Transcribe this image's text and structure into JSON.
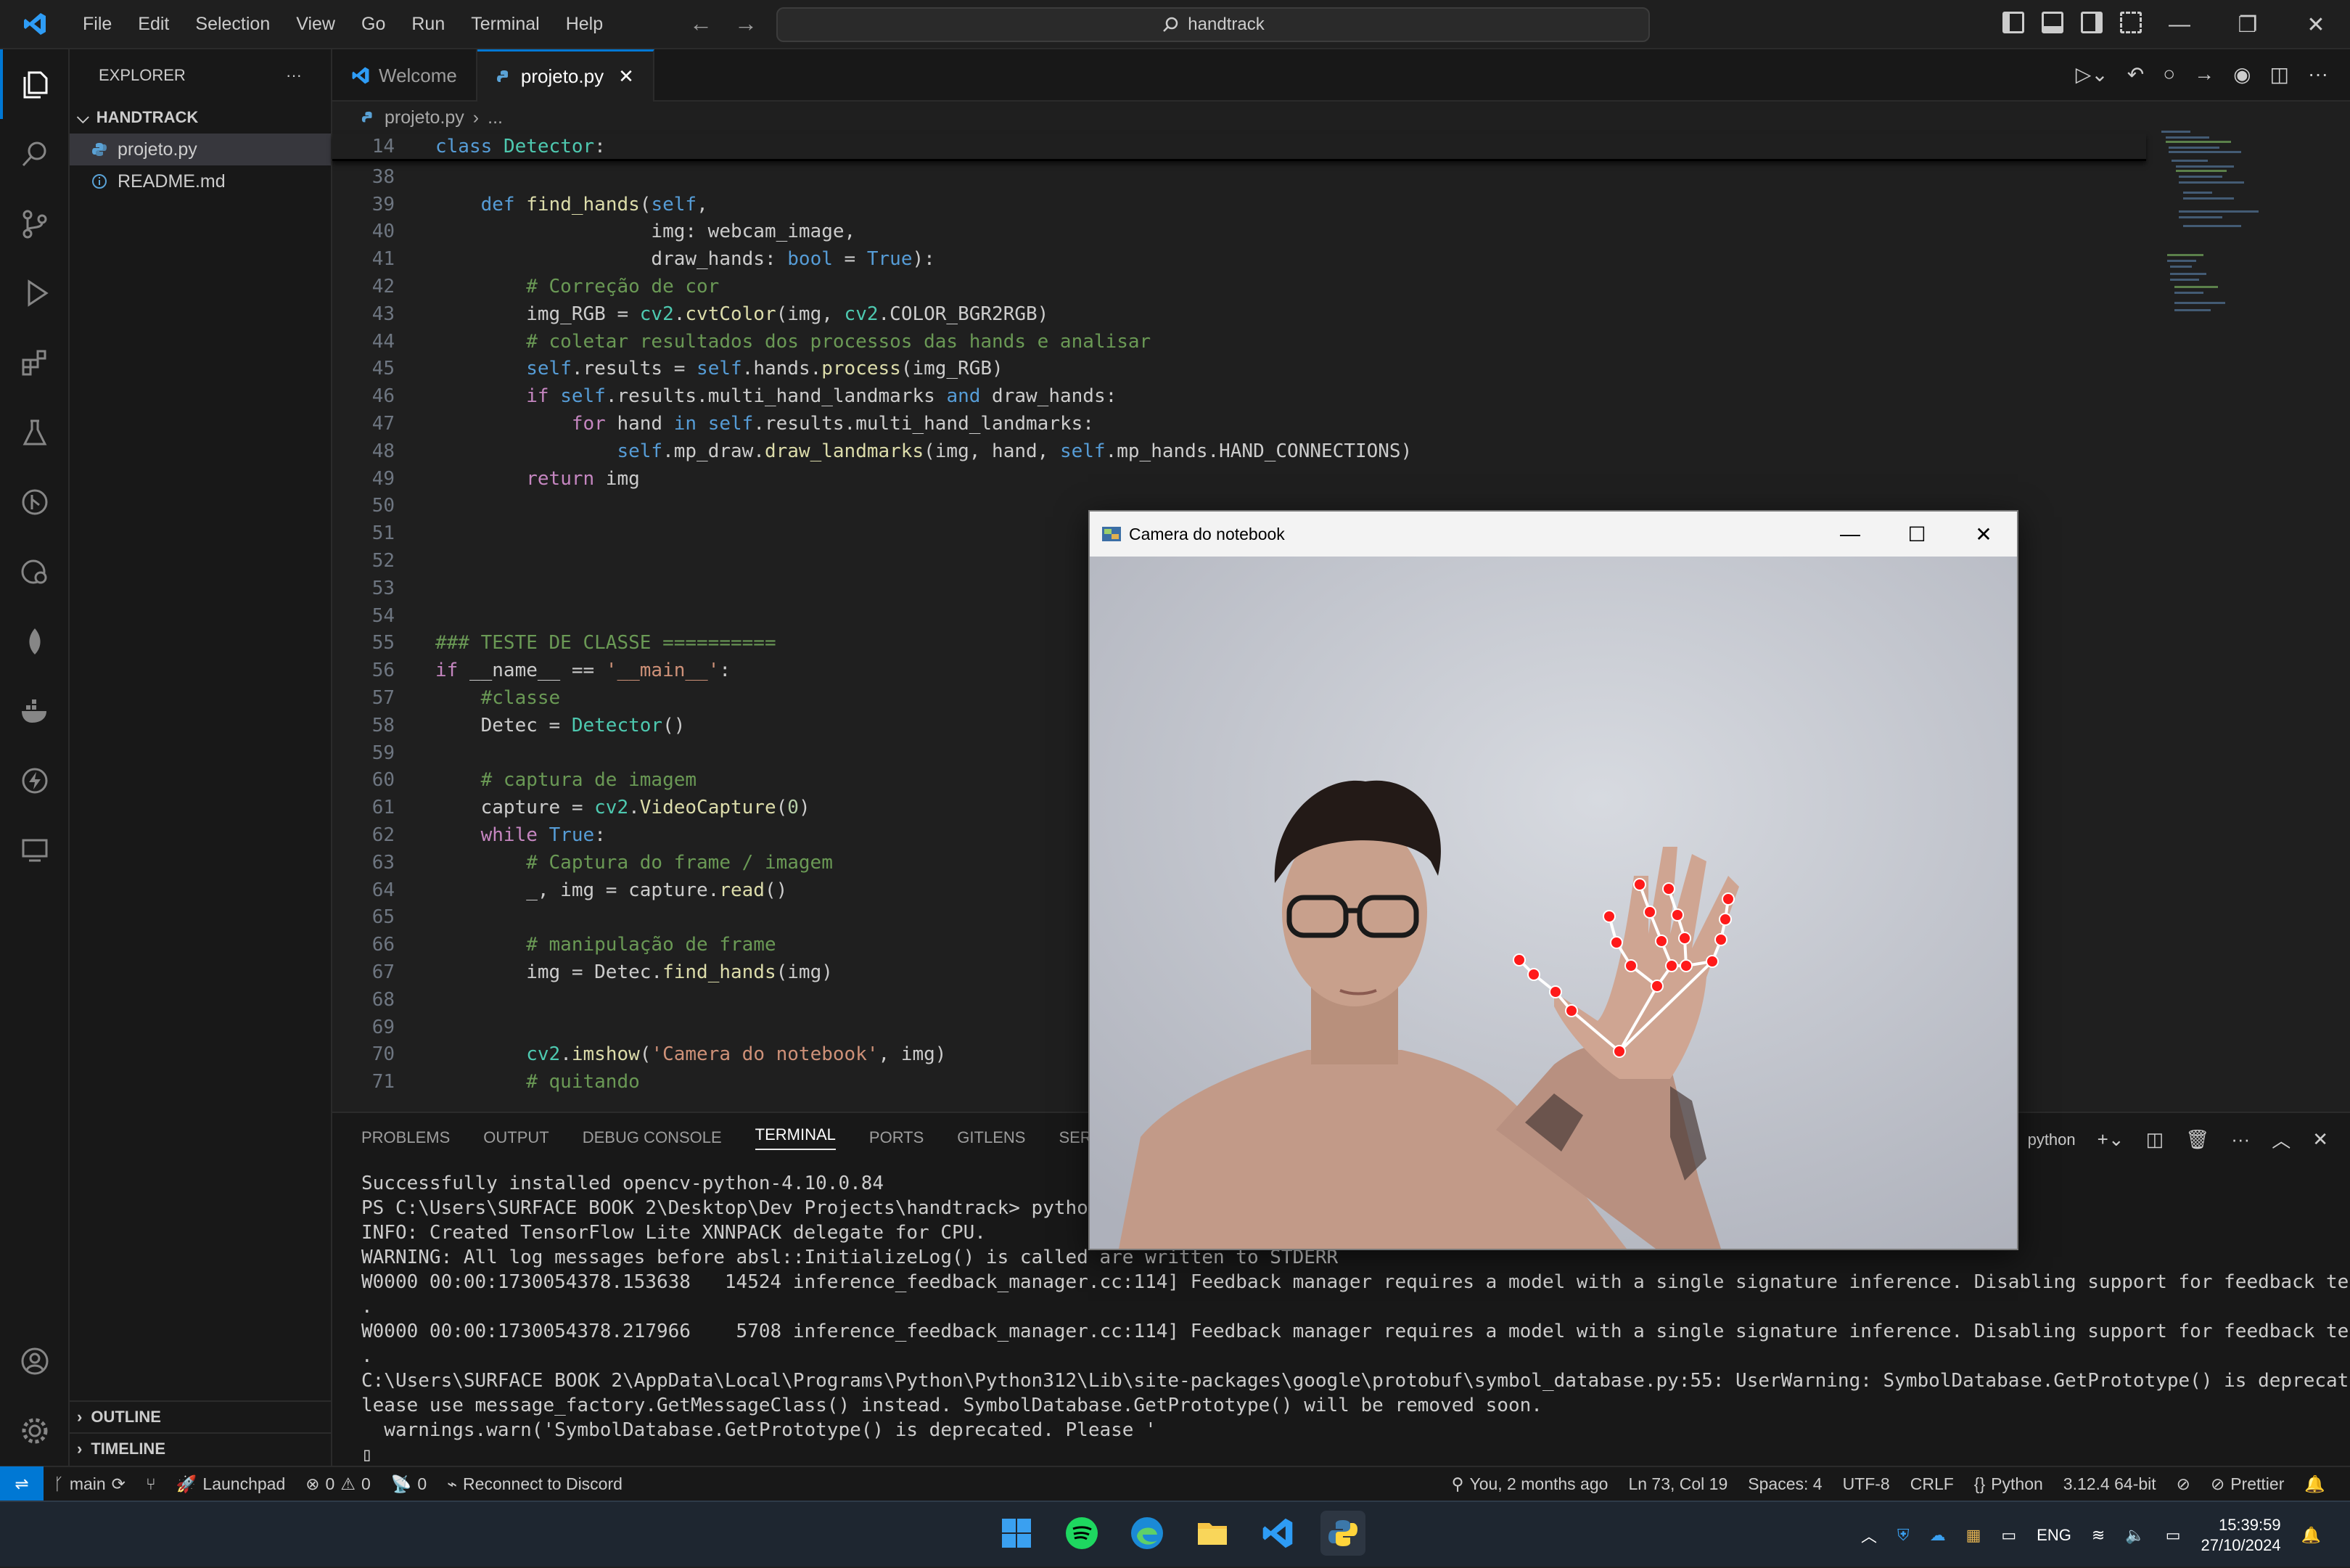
{
  "titlebar": {
    "menu": [
      "File",
      "Edit",
      "Selection",
      "View",
      "Go",
      "Run",
      "Terminal",
      "Help"
    ],
    "command_center": "handtrack"
  },
  "sidebar": {
    "header": "EXPLORER",
    "folder": "HANDTRACK",
    "files": [
      {
        "name": "projeto.py",
        "icon": "python-file-icon"
      },
      {
        "name": "README.md",
        "icon": "info-icon"
      }
    ],
    "outline": "OUTLINE",
    "timeline": "TIMELINE"
  },
  "editor": {
    "tabs": [
      {
        "label": "Welcome",
        "active": false
      },
      {
        "label": "projeto.py",
        "active": true
      }
    ],
    "breadcrumb": [
      "projeto.py",
      "..."
    ]
  },
  "code": {
    "sticky": {
      "n": "14",
      "text": "class Detector:"
    },
    "lines": [
      {
        "n": "38",
        "text": ""
      },
      {
        "n": "39",
        "text": "    def find_hands(self,"
      },
      {
        "n": "40",
        "text": "                   img: webcam_image,"
      },
      {
        "n": "41",
        "text": "                   draw_hands: bool = True):"
      },
      {
        "n": "42",
        "text": "        # Correção de cor"
      },
      {
        "n": "43",
        "text": "        img_RGB = cv2.cvtColor(img, cv2.COLOR_BGR2RGB)"
      },
      {
        "n": "44",
        "text": "        # coletar resultados dos processos das hands e analisar"
      },
      {
        "n": "45",
        "text": "        self.results = self.hands.process(img_RGB)"
      },
      {
        "n": "46",
        "text": "        if self.results.multi_hand_landmarks and draw_hands:"
      },
      {
        "n": "47",
        "text": "            for hand in self.results.multi_hand_landmarks:"
      },
      {
        "n": "48",
        "text": "                self.mp_draw.draw_landmarks(img, hand, self.mp_hands.HAND_CONNECTIONS)"
      },
      {
        "n": "49",
        "text": "        return img"
      },
      {
        "n": "50",
        "text": ""
      },
      {
        "n": "51",
        "text": ""
      },
      {
        "n": "52",
        "text": ""
      },
      {
        "n": "53",
        "text": ""
      },
      {
        "n": "54",
        "text": ""
      },
      {
        "n": "55",
        "text": "### TESTE DE CLASSE =========="
      },
      {
        "n": "56",
        "text": "if __name__ == '__main__':"
      },
      {
        "n": "57",
        "text": "    #classe"
      },
      {
        "n": "58",
        "text": "    Detec = Detector()"
      },
      {
        "n": "59",
        "text": ""
      },
      {
        "n": "60",
        "text": "    # captura de imagem"
      },
      {
        "n": "61",
        "text": "    capture = cv2.VideoCapture(0)"
      },
      {
        "n": "62",
        "text": "    while True:"
      },
      {
        "n": "63",
        "text": "        # Captura do frame / imagem"
      },
      {
        "n": "64",
        "text": "        _, img = capture.read()"
      },
      {
        "n": "65",
        "text": ""
      },
      {
        "n": "66",
        "text": "        # manipulação de frame"
      },
      {
        "n": "67",
        "text": "        img = Detec.find_hands(img)"
      },
      {
        "n": "68",
        "text": ""
      },
      {
        "n": "69",
        "text": ""
      },
      {
        "n": "70",
        "text": "        cv2.imshow('Camera do notebook', img)"
      },
      {
        "n": "71",
        "text": "        # quitando"
      }
    ]
  },
  "panel": {
    "tabs": [
      {
        "label": "PROBLEMS",
        "active": false
      },
      {
        "label": "OUTPUT",
        "active": false
      },
      {
        "label": "DEBUG CONSOLE",
        "active": false
      },
      {
        "label": "TERMINAL",
        "active": true
      },
      {
        "label": "PORTS",
        "active": false
      },
      {
        "label": "GITLENS",
        "active": false
      },
      {
        "label": "SERIAL MO",
        "active": false
      }
    ],
    "shell": "python",
    "terminal_lines": [
      "Successfully installed opencv-python-4.10.0.84",
      "PS C:\\Users\\SURFACE BOOK 2\\Desktop\\Dev Projects\\handtrack> python p",
      "INFO: Created TensorFlow Lite XNNPACK delegate for CPU.",
      "WARNING: All log messages before absl::InitializeLog() is called are written to STDERR",
      "W0000 00:00:1730054378.153638   14524 inference_feedback_manager.cc:114] Feedback manager requires a model with a single signature inference. Disabling support for feedback tensors",
      ".",
      "W0000 00:00:1730054378.217966    5708 inference_feedback_manager.cc:114] Feedback manager requires a model with a single signature inference. Disabling support for feedback tensors",
      ".",
      "C:\\Users\\SURFACE BOOK 2\\AppData\\Local\\Programs\\Python\\Python312\\Lib\\site-packages\\google\\protobuf\\symbol_database.py:55: UserWarning: SymbolDatabase.GetPrototype() is deprecated. P",
      "lease use message_factory.GetMessageClass() instead. SymbolDatabase.GetPrototype() will be removed soon.",
      "  warnings.warn('SymbolDatabase.GetPrototype() is deprecated. Please '",
      "▯"
    ]
  },
  "statusbar": {
    "branch": "main",
    "launchpad": "Launchpad",
    "errors": "0",
    "warnings": "0",
    "ports": "0",
    "discord": "Reconnect to Discord",
    "blame": "You, 2 months ago",
    "position": "Ln 73, Col 19",
    "spaces": "Spaces: 4",
    "encoding": "UTF-8",
    "eol": "CRLF",
    "language": "Python",
    "interpreter": "3.12.4 64-bit",
    "prettier": "Prettier"
  },
  "camera_window": {
    "title": "Camera do notebook"
  },
  "taskbar": {
    "language": "ENG",
    "time": "15:39:59",
    "date": "27/10/2024"
  },
  "colors": {
    "accent": "#0078d4",
    "landmark": "#ff1a1a",
    "connection": "#ffffff"
  }
}
